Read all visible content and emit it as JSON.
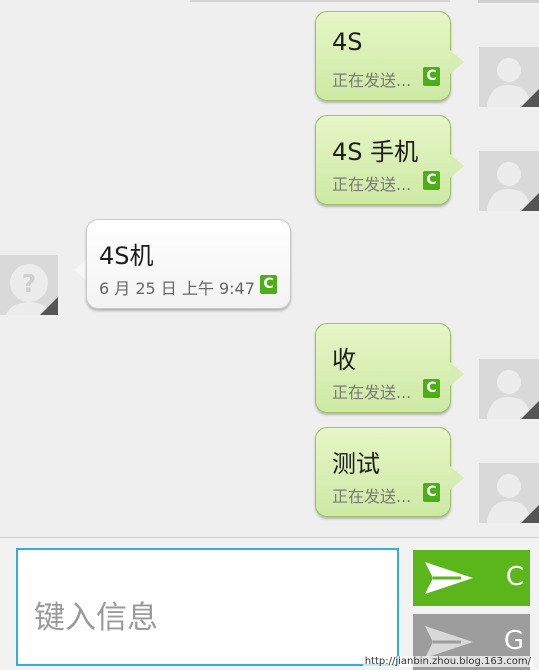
{
  "messages": [
    {
      "direction": "out",
      "text": "4S",
      "status": "正在发送...",
      "badge": "C"
    },
    {
      "direction": "out",
      "text": "4S 手机",
      "status": "正在发送...",
      "badge": "C"
    },
    {
      "direction": "in",
      "text": "4S机",
      "status": "6 月 25 日 上午 9:47",
      "badge": "C"
    },
    {
      "direction": "out",
      "text": "收",
      "status": "正在发送...",
      "badge": "C"
    },
    {
      "direction": "out",
      "text": "测试",
      "status": "正在发送...",
      "badge": "C"
    }
  ],
  "composer": {
    "placeholder": "键入信息",
    "send_primary_label": "C",
    "send_secondary_label": "G"
  },
  "colors": {
    "outgoing_bubble": "#d6eeb1",
    "incoming_bubble": "#ffffff",
    "accent_blue": "#33aee0",
    "send_green": "#5bb61b",
    "badge_green": "#4caf17"
  },
  "watermark": "http://jianbin.zhou.blog.163.com/"
}
